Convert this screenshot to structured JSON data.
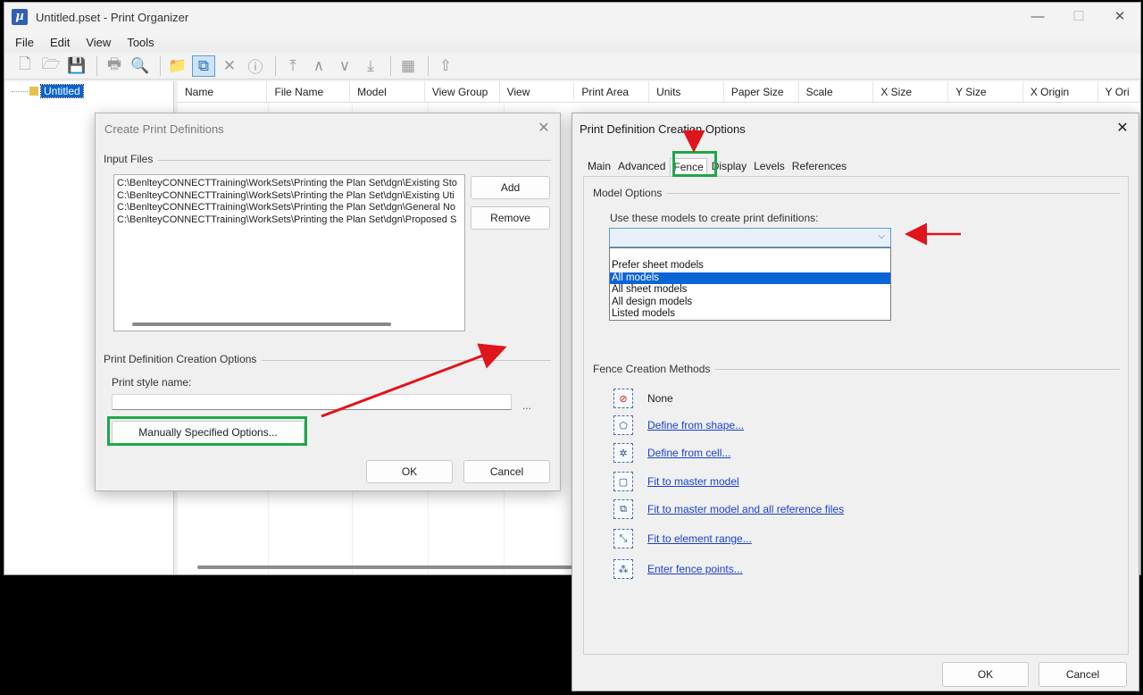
{
  "app": {
    "title": "Untitled.pset - Print Organizer",
    "icon": "microstation-app-icon",
    "controls": {
      "minimize": "—",
      "maximize": "☐",
      "close": "✕"
    }
  },
  "menu": [
    "File",
    "Edit",
    "View",
    "Tools"
  ],
  "toolbar": {
    "icons": [
      "new-icon",
      "open-icon",
      "save-icon",
      "print-icon",
      "preview-icon",
      "add-folder-icon",
      "create-definitions-icon",
      "delete-icon",
      "properties-icon",
      "move-top-icon",
      "move-up-icon",
      "move-down-icon",
      "move-bottom-icon",
      "columns-icon",
      "export-icon"
    ],
    "glyphs": [
      "🗋",
      "🗁",
      "💾",
      "🖶",
      "🔍",
      "📁",
      "⧉",
      "✕",
      "ⓘ",
      "⤒",
      "∧",
      "∨",
      "⤓",
      "▦",
      "⇧"
    ]
  },
  "tree": {
    "root_label": "Untitled"
  },
  "grid": {
    "columns": [
      "Name",
      "File Name",
      "Model",
      "View Group",
      "View",
      "Print Area",
      "Units",
      "Paper Size",
      "Scale",
      "X Size",
      "Y Size",
      "X Origin",
      "Y Ori"
    ]
  },
  "create_dialog": {
    "title": "Create Print Definitions",
    "close_glyph": "✕",
    "input_files_label": "Input Files",
    "files": [
      "C:\\BenlteyCONNECTTraining\\WorkSets\\Printing the Plan Set\\dgn\\Existing Sto",
      "C:\\BenlteyCONNECTTraining\\WorkSets\\Printing the Plan Set\\dgn\\Existing Uti",
      "C:\\BenlteyCONNECTTraining\\WorkSets\\Printing the Plan Set\\dgn\\General No",
      "C:\\BenlteyCONNECTTraining\\WorkSets\\Printing the Plan Set\\dgn\\Proposed S"
    ],
    "add_label": "Add",
    "remove_label": "Remove",
    "options_group_label": "Print Definition Creation Options",
    "print_style_label": "Print style name:",
    "print_style_value": "",
    "ellipsis": "...",
    "manual_options_label": "Manually Specified Options...",
    "ok_label": "OK",
    "cancel_label": "Cancel"
  },
  "options_dialog": {
    "title": "Print Definition Creation Options",
    "close_glyph": "✕",
    "tabs": [
      "Main",
      "Advanced",
      "Fence",
      "Display",
      "Levels",
      "References"
    ],
    "selected_tab": "Fence",
    "model_options_label": "Model Options",
    "use_models_label": "Use these models to create print definitions:",
    "combo_value": "",
    "combo_arrow": "⌵",
    "dropdown_options": [
      "Prefer sheet models",
      "All models",
      "All sheet models",
      "All design models",
      "Listed models"
    ],
    "dropdown_selected": "All models",
    "fence_methods_label": "Fence Creation Methods",
    "methods": [
      {
        "label": "None",
        "icon": "fence-none-icon",
        "glyph": "⊘",
        "link": false
      },
      {
        "label": "Define from shape...",
        "icon": "fence-shape-icon",
        "glyph": "⬠",
        "link": true
      },
      {
        "label": "Define from cell...",
        "icon": "fence-cell-icon",
        "glyph": "✲",
        "link": true
      },
      {
        "label": "Fit to master model",
        "icon": "fence-master-model-icon",
        "glyph": "▢",
        "link": true
      },
      {
        "label": "Fit to master model and all reference files",
        "icon": "fence-master-reference-icon",
        "glyph": "⧉",
        "link": true
      },
      {
        "label": "Fit to element range...",
        "icon": "fence-element-range-icon",
        "glyph": "⤡",
        "link": true
      },
      {
        "label": "Enter fence points...",
        "icon": "fence-points-icon",
        "glyph": "⁂",
        "link": true
      }
    ],
    "ok_label": "OK",
    "cancel_label": "Cancel"
  },
  "annotations": {
    "arrow_color": "#e0141b",
    "highlight_color": "#1ea84a"
  }
}
